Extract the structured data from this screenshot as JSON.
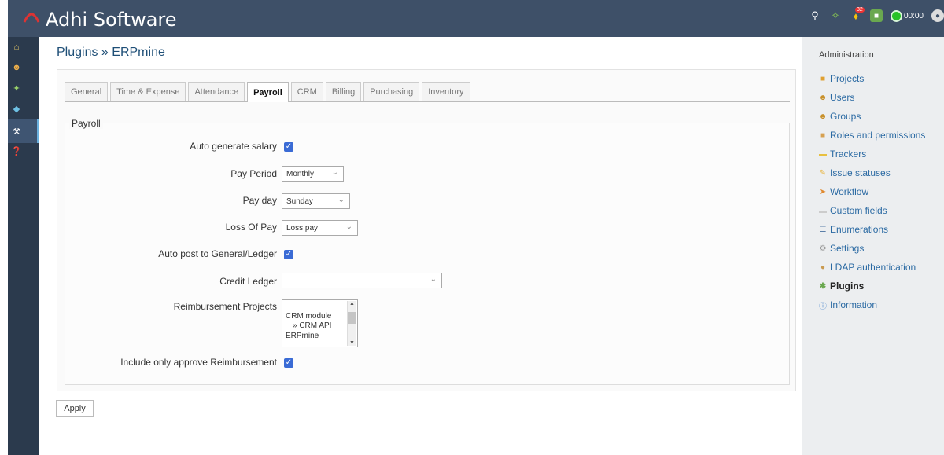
{
  "header": {
    "app_title": "Adhi Software",
    "timer_text": "00:00",
    "notification_count": "32"
  },
  "breadcrumb": {
    "parent": "Plugins",
    "separator": " » ",
    "current": "ERPmine"
  },
  "tabs": [
    {
      "label": "General"
    },
    {
      "label": "Time & Expense"
    },
    {
      "label": "Attendance"
    },
    {
      "label": "Payroll",
      "active": true
    },
    {
      "label": "CRM"
    },
    {
      "label": "Billing"
    },
    {
      "label": "Purchasing"
    },
    {
      "label": "Inventory"
    }
  ],
  "form": {
    "section_title": "Payroll",
    "auto_generate_salary_label": "Auto generate salary",
    "auto_generate_salary_checked": true,
    "pay_period_label": "Pay Period",
    "pay_period_value": "Monthly",
    "pay_day_label": "Pay day",
    "pay_day_value": "Sunday",
    "loss_of_pay_label": "Loss Of Pay",
    "loss_of_pay_value": "Loss pay",
    "auto_post_label": "Auto post to General/Ledger",
    "auto_post_checked": true,
    "credit_ledger_label": "Credit Ledger",
    "credit_ledger_value": "",
    "reimbursement_projects_label": "Reimbursement Projects",
    "reimbursement_projects_options": [
      "CRM module",
      "» CRM API",
      "ERPmine"
    ],
    "include_approve_label": "Include only approve Reimbursement",
    "include_approve_checked": true,
    "apply_label": "Apply"
  },
  "admin_panel": {
    "title": "Administration",
    "items": [
      {
        "label": "Projects",
        "icon": "projects-icon"
      },
      {
        "label": "Users",
        "icon": "users-icon"
      },
      {
        "label": "Groups",
        "icon": "groups-icon"
      },
      {
        "label": "Roles and permissions",
        "icon": "roles-icon"
      },
      {
        "label": "Trackers",
        "icon": "trackers-icon"
      },
      {
        "label": "Issue statuses",
        "icon": "issue-statuses-icon"
      },
      {
        "label": "Workflow",
        "icon": "workflow-icon"
      },
      {
        "label": "Custom fields",
        "icon": "custom-fields-icon"
      },
      {
        "label": "Enumerations",
        "icon": "enumerations-icon"
      },
      {
        "label": "Settings",
        "icon": "settings-icon"
      },
      {
        "label": "LDAP authentication",
        "icon": "ldap-icon"
      },
      {
        "label": "Plugins",
        "icon": "plugins-icon",
        "selected": true
      },
      {
        "label": "Information",
        "icon": "information-icon"
      }
    ]
  },
  "colors": {
    "topbar": "#3e5068",
    "leftbar": "#2b3a4d",
    "link": "#2b6aa3",
    "checkbox": "#3a6bd5"
  }
}
